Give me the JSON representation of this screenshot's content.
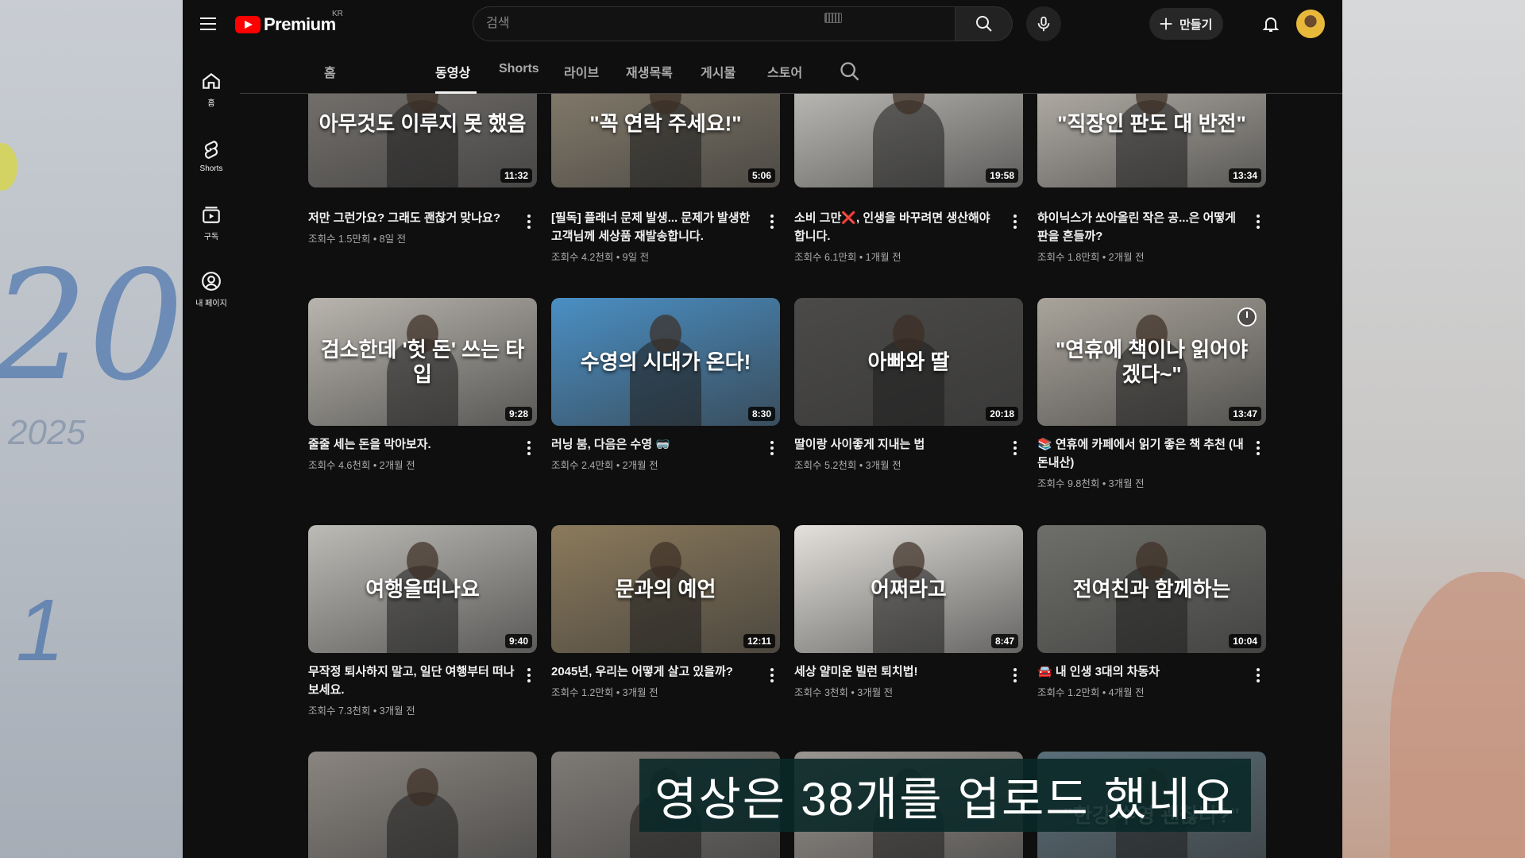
{
  "header": {
    "logo_text": "Premium",
    "region": "KR",
    "search_placeholder": "검색",
    "create_label": "만들기"
  },
  "guide": [
    {
      "label": "홈",
      "icon": "home-icon"
    },
    {
      "label": "Shorts",
      "icon": "shorts-icon"
    },
    {
      "label": "구독",
      "icon": "subscriptions-icon"
    },
    {
      "label": "내 페이지",
      "icon": "account-icon"
    }
  ],
  "tabs": [
    "홈",
    "동영상",
    "Shorts",
    "라이브",
    "재생목록",
    "게시물",
    "스토어"
  ],
  "active_tab": "동영상",
  "videos": [
    {
      "thumb_text": "아무것도 이루지 못 했음",
      "duration": "11:32",
      "title": "저만 그런가요? 그래도 괜찮거 맞나요?",
      "meta": "조회수 1.5만회 • 8일 전",
      "color": "#7a7672"
    },
    {
      "thumb_text": "\"꼭 연락 주세요!\"",
      "duration": "5:06",
      "title": "[필독] 플래너 문제 발생... 문제가 발생한 고객님께 세상품 재발송합니다.",
      "meta": "조회수 4.2천회 • 9일 전",
      "color": "#8a8170"
    },
    {
      "thumb_text": "",
      "duration": "19:58",
      "title": "소비 그만❌, 인생을 바꾸려면 생산해야 합니다.",
      "meta": "조회수 6.1만회 • 1개월 전",
      "color": "#c9c7c2"
    },
    {
      "thumb_text": "\"직장인 판도 대 반전\"",
      "duration": "13:34",
      "title": "하이닉스가 쏘아올린 작은 공...은 어떻게 판을 흔들까?",
      "meta": "조회수 1.8만회 • 2개월 전",
      "color": "#bdb8b0"
    },
    {
      "thumb_text": "검소한데 '헛 돈' 쓰는 타입",
      "duration": "9:28",
      "title": "줄줄 세는 돈을 막아보자.",
      "meta": "조회수 4.6천회 • 2개월 전",
      "color": "#b9b5ae"
    },
    {
      "thumb_text": "수영의 시대가 온다!",
      "duration": "8:30",
      "title": "러닝 붐, 다음은 수영 🥽",
      "meta": "조회수 2.4만회 • 2개월 전",
      "color": "#4a8fc4"
    },
    {
      "thumb_text": "아빠와 딸",
      "duration": "20:18",
      "title": "딸이랑 사이좋게 지내는 법",
      "meta": "조회수 5.2천회 • 3개월 전",
      "color": "#4b4a48"
    },
    {
      "thumb_text": "\"연휴에 책이나 읽어야 겠다~\"",
      "duration": "13:47",
      "title": "📚 연휴에 카페에서 읽기 좋은 책 추천 (내돈내산)",
      "meta": "조회수 9.8천회 • 3개월 전",
      "color": "#a9a49b"
    },
    {
      "thumb_text": "여행을떠나요",
      "duration": "9:40",
      "title": "무작정 퇴사하지 말고, 일단 여행부터 떠나보세요.",
      "meta": "조회수 7.3천회 • 3개월 전",
      "color": "#bdbbb6"
    },
    {
      "thumb_text": "문과의 예언",
      "duration": "12:11",
      "title": "2045년, 우리는 어떻게 살고 있을까?",
      "meta": "조회수 1.2만회 • 3개월 전",
      "color": "#8b7a5c"
    },
    {
      "thumb_text": "어쩌라고",
      "duration": "8:47",
      "title": "세상 얄미운 빌런 퇴치법!",
      "meta": "조회수 3천회 • 3개월 전",
      "color": "#e4e1dc"
    },
    {
      "thumb_text": "전여친과 함께하는",
      "duration": "10:04",
      "title": "🚘 내 인생 3대의 차동차",
      "meta": "조회수 1.2만회 • 4개월 전",
      "color": "#6e6f6a"
    },
    {
      "thumb_text": "",
      "duration": "",
      "title": "",
      "meta": "",
      "color": "#8a8580"
    },
    {
      "thumb_text": "",
      "duration": "",
      "title": "",
      "meta": "",
      "color": "#7e7a76"
    },
    {
      "thumb_text": "",
      "duration": "",
      "title": "",
      "meta": "",
      "color": "#9a9590"
    },
    {
      "thumb_text": "\"한강 수영 괜찮나?\"",
      "duration": "",
      "title": "",
      "meta": "",
      "color": "#5a6e78"
    }
  ],
  "subtitle": "영상은 38개를 업로드 했네요",
  "colors": {
    "accent": "#ff0000",
    "bg": "#0f0f0f"
  }
}
